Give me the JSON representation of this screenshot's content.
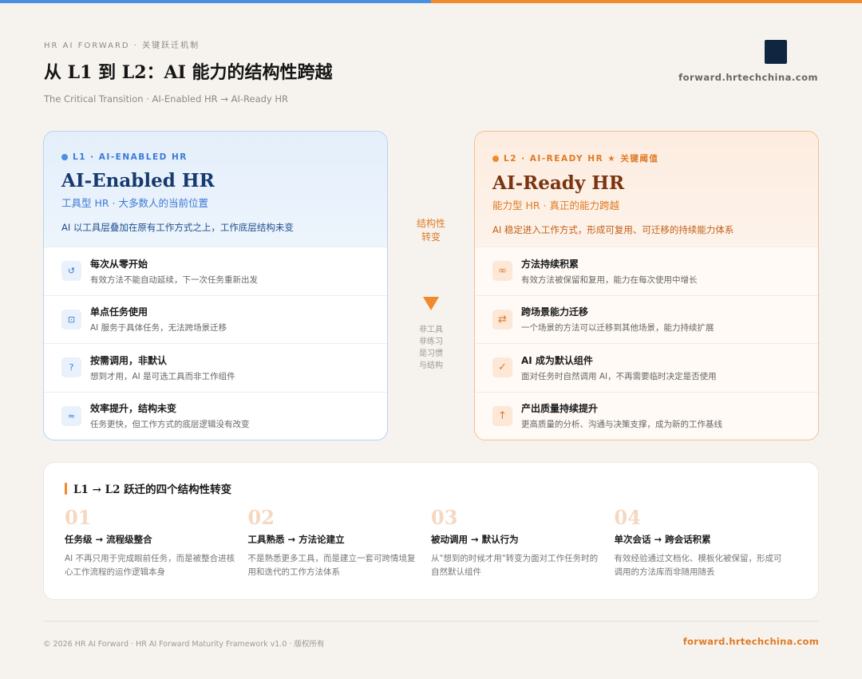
{
  "header": {
    "eyebrow": "HR AI FORWARD  ·  关键跃迁机制",
    "title": "从 L1 到 L2：AI 能力的结构性跨越",
    "subtitle": "The Critical Transition  ·  AI-Enabled HR → AI-Ready HR",
    "site": "forward.hrtechchina.com"
  },
  "l1": {
    "badge": "L1  ·  AI-ENABLED HR",
    "title": "AI-Enabled HR",
    "subtitle": "工具型 HR · 大多数人的当前位置",
    "description": "AI 以工具层叠加在原有工作方式之上，工作底层结构未变",
    "items": [
      {
        "icon": "↺",
        "icon_name": "refresh-icon",
        "title": "每次从零开始",
        "desc": "有效方法不能自动延续，下一次任务重新出发"
      },
      {
        "icon": "⊡",
        "icon_name": "square-dot-icon",
        "title": "单点任务使用",
        "desc": "AI 服务于具体任务，无法跨场景迁移"
      },
      {
        "icon": "?",
        "icon_name": "question-icon",
        "title": "按需调用，非默认",
        "desc": "想到才用，AI 是可选工具而非工作组件"
      },
      {
        "icon": "≈",
        "icon_name": "approx-icon",
        "title": "效率提升，结构未变",
        "desc": "任务更快，但工作方式的底层逻辑没有改变"
      }
    ]
  },
  "l2": {
    "badge": "L2  ·  AI-READY HR ★ 关键阈值",
    "title": "AI-Ready HR",
    "subtitle": "能力型 HR · 真正的能力跨越",
    "description": "AI 稳定进入工作方式，形成可复用、可迁移的持续能力体系",
    "items": [
      {
        "icon": "∞",
        "icon_name": "infinity-icon",
        "title": "方法持续积累",
        "desc": "有效方法被保留和复用，能力在每次使用中增长"
      },
      {
        "icon": "⇄",
        "icon_name": "swap-icon",
        "title": "跨场景能力迁移",
        "desc": "一个场景的方法可以迁移到其他场景，能力持续扩展"
      },
      {
        "icon": "✓",
        "icon_name": "check-icon",
        "title": "AI 成为默认组件",
        "desc": "面对任务时自然调用 AI，不再需要临时决定是否使用"
      },
      {
        "icon": "↑",
        "icon_name": "arrow-up-icon",
        "title": "产出质量持续提升",
        "desc": "更高质量的分析、沟通与决策支撑，成为新的工作基线"
      }
    ]
  },
  "middle": {
    "label_line1": "结构性",
    "label_line2": "转变",
    "notes": [
      "非工具",
      "非练习",
      "是习惯",
      "与结构"
    ]
  },
  "bottom": {
    "title": "L1 → L2 跃迁的四个结构性转变",
    "steps": [
      {
        "num": "01",
        "title": "任务级 → 流程级整合",
        "desc": "AI 不再只用于完成眼前任务，而是被整合进核心工作流程的运作逻辑本身"
      },
      {
        "num": "02",
        "title": "工具熟悉 → 方法论建立",
        "desc": "不是熟悉更多工具，而是建立一套可跨情境复用和迭代的工作方法体系"
      },
      {
        "num": "03",
        "title": "被动调用 → 默认行为",
        "desc": "从\"想到的时候才用\"转变为面对工作任务时的自然默认组件"
      },
      {
        "num": "04",
        "title": "单次会话 → 跨会话积累",
        "desc": "有效经验通过文档化、模板化被保留，形成可调用的方法库而非随用随丢"
      }
    ]
  },
  "footer": {
    "copyright": "© 2026 HR AI Forward  ·  HR AI Forward Maturity Framework v1.0  ·  版权所有",
    "site": "forward.hrtechchina.com"
  },
  "colors": {
    "blue": "#4a90e2",
    "orange": "#f08a2c",
    "navy": "#0f2540"
  }
}
